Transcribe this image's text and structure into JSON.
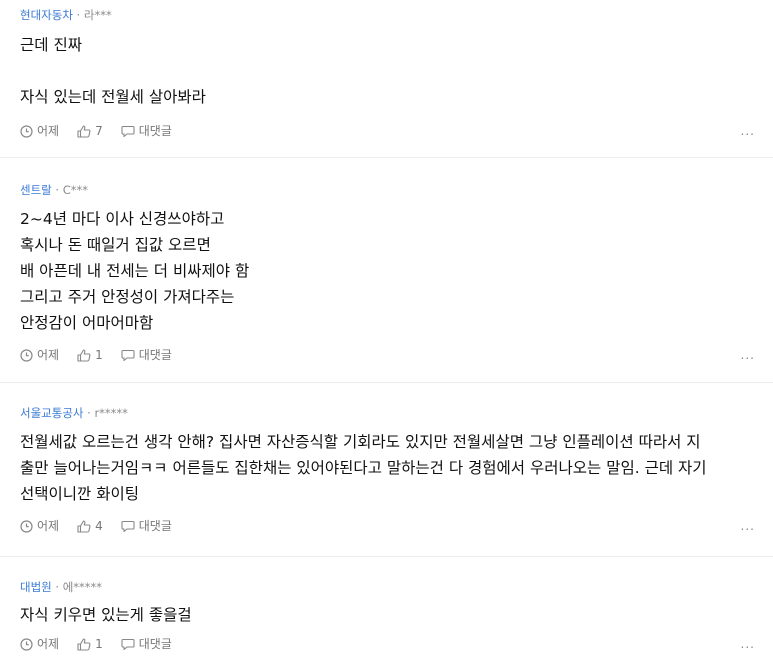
{
  "comments": [
    {
      "company": "현대자동차",
      "separator": " · ",
      "author": "라***",
      "text": "근데 진짜\n\n자식 있는데 전월세 살아봐라",
      "time": "어제",
      "likes": "7",
      "reply_label": "대댓글"
    },
    {
      "company": "센트랄",
      "separator": " · ",
      "author": "C***",
      "text": "2~4년 마다 이사 신경쓰야하고\n혹시나 돈 때일거 집값 오르면\n배 아픈데 내 전세는 더 비싸제야 함\n그리고 주거 안정성이 가져다주는\n안정감이 어마어마함",
      "time": "어제",
      "likes": "1",
      "reply_label": "대댓글"
    },
    {
      "company": "서울교통공사",
      "separator": " · ",
      "author": "r*****",
      "text": "전월세값 오르는건 생각 안해? 집사면 자산증식할 기회라도 있지만 전월세살면 그냥 인플레이션 따라서 지\n출만 늘어나는거임ㅋㅋ 어른들도 집한채는 있어야된다고 말하는건 다 경험에서 우러나오는 말임. 근데 자기\n선택이니깐 화이팅",
      "time": "어제",
      "likes": "4",
      "reply_label": "대댓글"
    },
    {
      "company": "대법원",
      "separator": " · ",
      "author": "에*****",
      "text": "자식 키우면 있는게 좋을걸",
      "time": "어제",
      "likes": "1",
      "reply_label": "대댓글"
    }
  ],
  "more_label": "...",
  "icons": {
    "time": "clock-icon",
    "like": "thumbs-up-icon",
    "reply": "speech-bubble-icon",
    "more": "more-dots-icon"
  },
  "colors": {
    "company": "#3b7bd4",
    "meta": "#8a8a8a",
    "body": "#111111",
    "divider": "#ececec"
  }
}
